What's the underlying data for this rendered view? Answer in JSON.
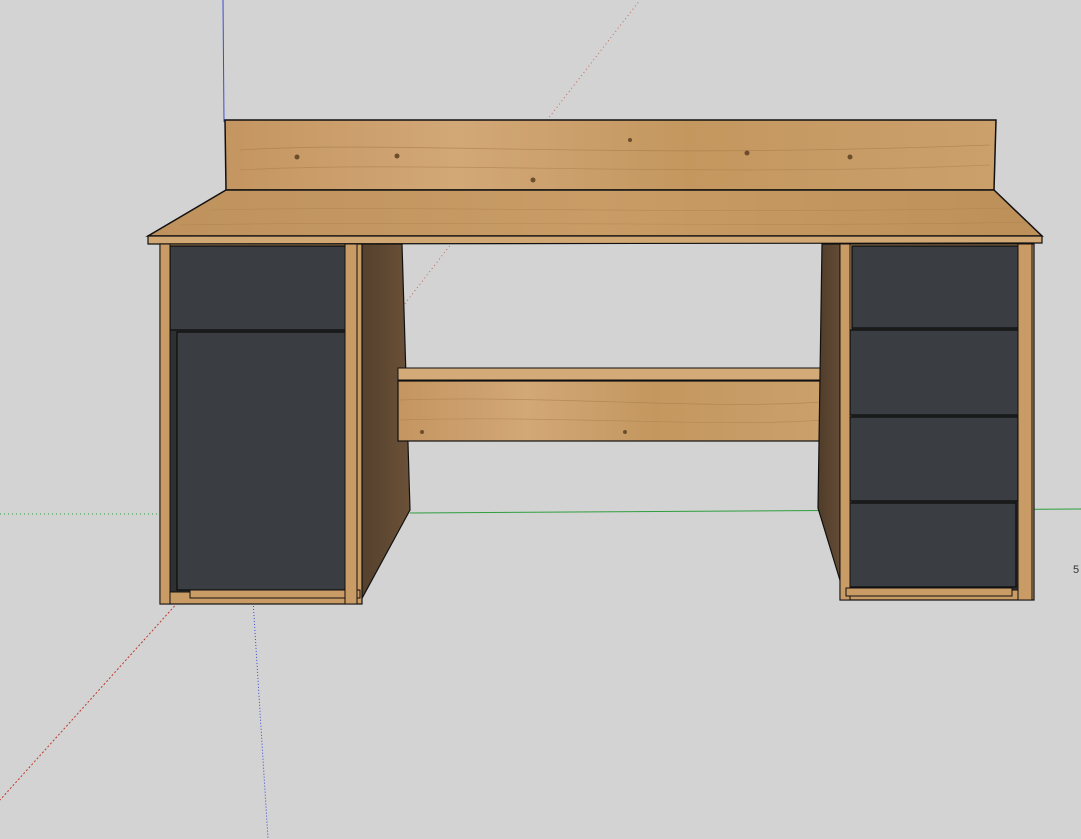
{
  "viewport": {
    "background": "#d3d3d3",
    "axes": {
      "red": "#c0392b",
      "green": "#2e9e3e",
      "blue": "#3b4bd0"
    }
  },
  "model": {
    "object": "desk",
    "wood_color": "#c79a62",
    "wood_dark": "#5a4430",
    "door_color": "#3a3d41",
    "drawers_right_count": 4,
    "drawers_left_count": 1,
    "doors_left_count": 1
  },
  "edge_text": "5"
}
